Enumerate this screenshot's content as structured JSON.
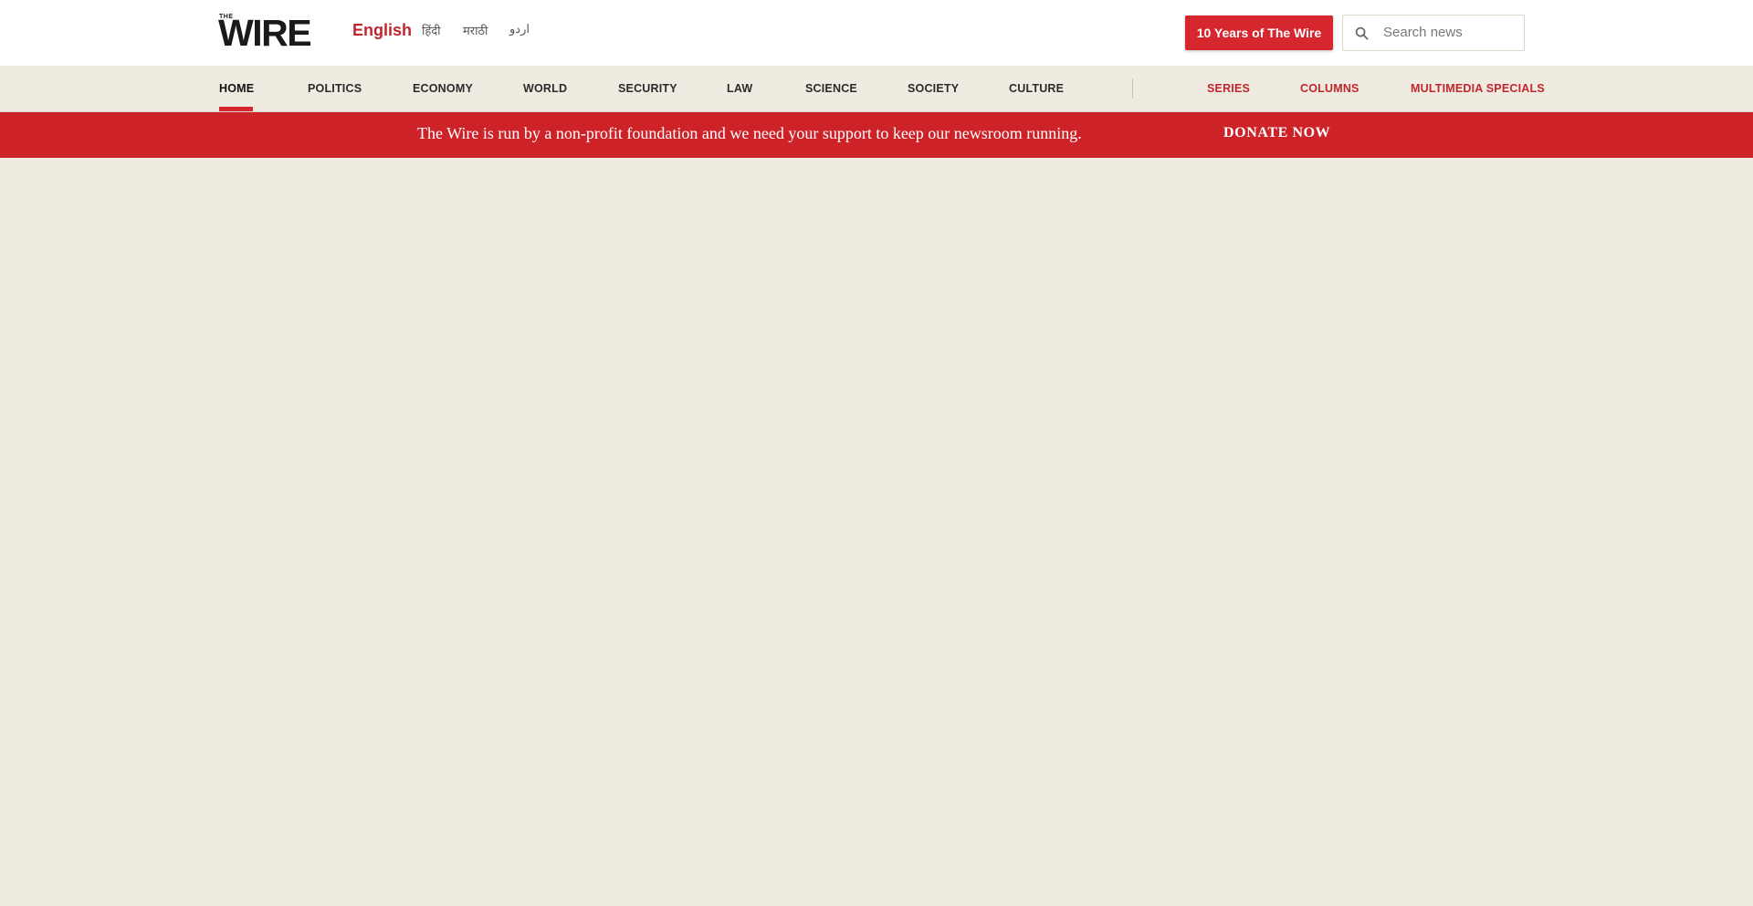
{
  "header": {
    "logo": {
      "small": "THE",
      "word": "WIRE"
    },
    "languages": [
      {
        "label": "English",
        "active": true
      },
      {
        "label": "हिंदी",
        "active": false
      },
      {
        "label": "मराठी",
        "active": false
      },
      {
        "label": "اردو",
        "active": false
      }
    ],
    "ten_years_button": "10 Years of The Wire",
    "search": {
      "placeholder": "Search news",
      "value": "",
      "icon": "search-icon"
    }
  },
  "nav": {
    "items": [
      {
        "label": "HOME",
        "active": true
      },
      {
        "label": "POLITICS"
      },
      {
        "label": "ECONOMY"
      },
      {
        "label": "WORLD"
      },
      {
        "label": "SECURITY"
      },
      {
        "label": "LAW"
      },
      {
        "label": "SCIENCE"
      },
      {
        "label": "SOCIETY"
      },
      {
        "label": "CULTURE"
      }
    ],
    "right_items": [
      {
        "label": "SERIES"
      },
      {
        "label": "COLUMNS"
      },
      {
        "label": "MULTIMEDIA SPECIALS"
      }
    ]
  },
  "donate": {
    "message": "The Wire is run by a non-profit foundation and we need your support to keep our newsroom running.",
    "button": "DONATE NOW"
  },
  "colors": {
    "accent_red": "#d6272e",
    "page_background": "#f0ebe1",
    "header_background": "#ffffff"
  }
}
